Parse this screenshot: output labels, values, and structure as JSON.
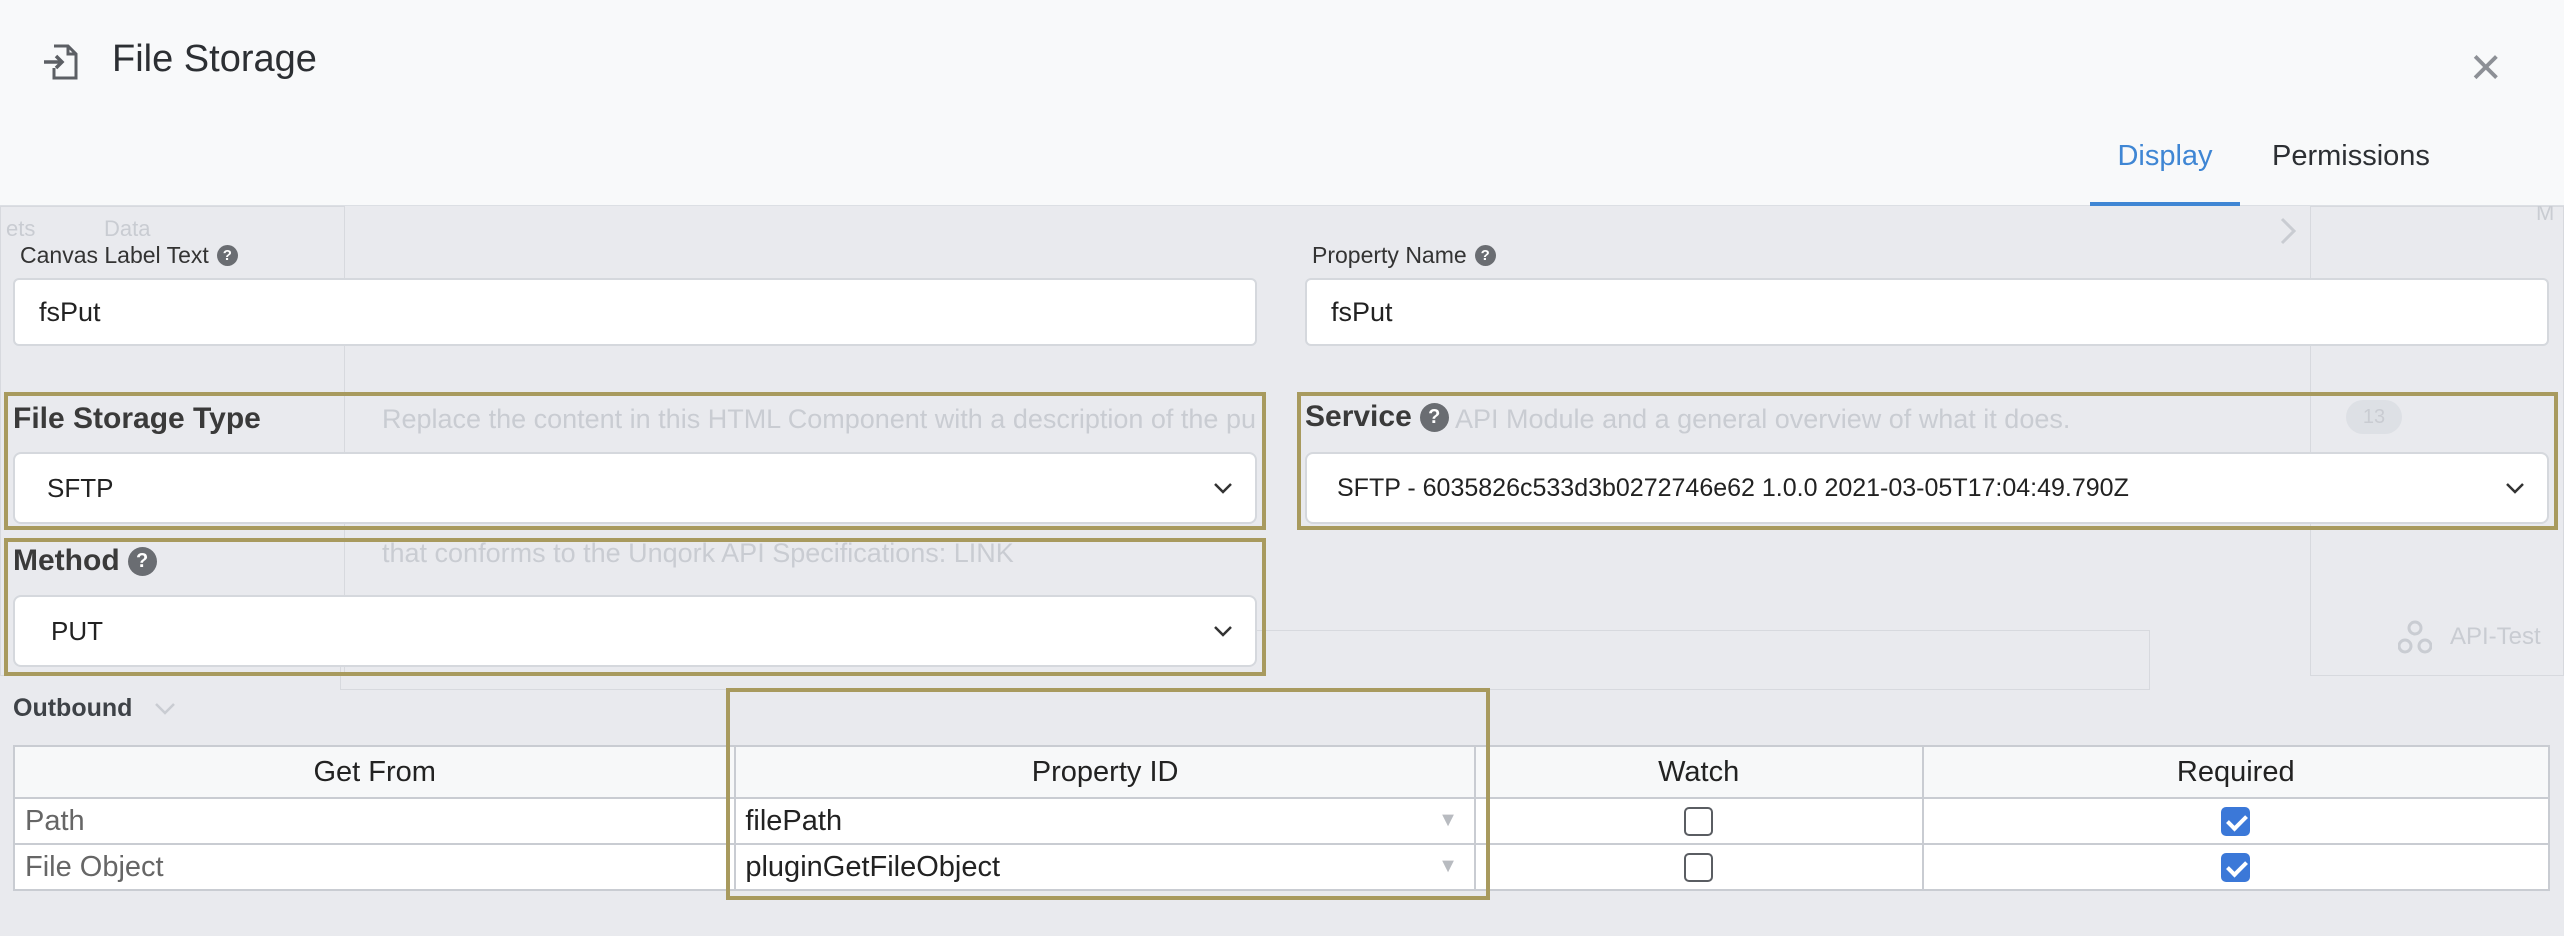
{
  "header": {
    "title": "File Storage",
    "icon": "file-import-icon",
    "tabs": [
      {
        "label": "Display",
        "active": true
      },
      {
        "label": "Permissions",
        "active": false
      }
    ]
  },
  "background": {
    "ghost_text_1": "Replace the content in this HTML Component with a description of the pu",
    "ghost_text_1b": "API Module and a general overview of what it does.",
    "ghost_text_2": "that conforms to the Unqork API Specifications: LINK",
    "ghost_tab_1": "ets",
    "ghost_tab_2": "Data",
    "ghost_badge": "13",
    "ghost_side_item": "API-Test",
    "ghost_corner": "M"
  },
  "form": {
    "canvas_label": {
      "label": "Canvas Label Text",
      "value": "fsPut"
    },
    "property_name": {
      "label": "Property Name",
      "value": "fsPut"
    },
    "file_storage_type": {
      "label": "File Storage Type",
      "value": "SFTP"
    },
    "service": {
      "label": "Service",
      "value": "SFTP - 6035826c533d3b0272746e62 1.0.0 2021-03-05T17:04:49.790Z"
    },
    "method": {
      "label": "Method",
      "value": "PUT"
    }
  },
  "outbound": {
    "label": "Outbound",
    "columns": [
      "Get From",
      "Property ID",
      "Watch",
      "Required"
    ],
    "rows": [
      {
        "get_from": "Path",
        "property_id": "filePath",
        "watch": false,
        "required": true
      },
      {
        "get_from": "File Object",
        "property_id": "pluginGetFileObject",
        "watch": false,
        "required": true
      }
    ]
  },
  "colors": {
    "accent": "#3f86d4",
    "highlight": "#a89a5e",
    "checkbox_on": "#3b78d8"
  }
}
